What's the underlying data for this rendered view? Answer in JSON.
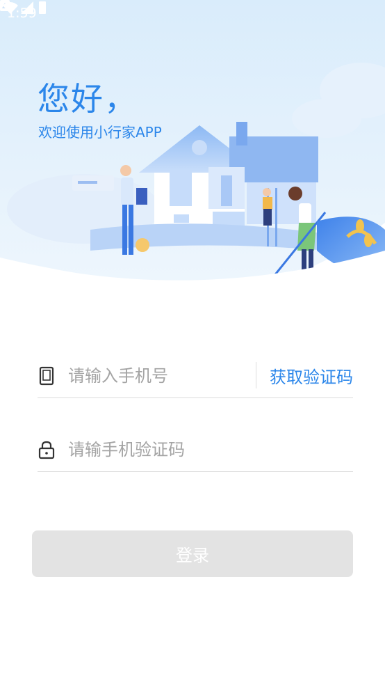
{
  "status_bar": {
    "time": "1:59"
  },
  "header": {
    "greeting": "您好，",
    "subtitle": "欢迎使用小行家APP"
  },
  "form": {
    "phone_placeholder": "请输入手机号",
    "get_code_label": "获取验证码",
    "code_placeholder": "请输手机验证码",
    "login_label": "登录"
  },
  "colors": {
    "accent": "#2b86ea",
    "button_disabled": "#e3e3e3",
    "placeholder": "#a4a4a4"
  }
}
